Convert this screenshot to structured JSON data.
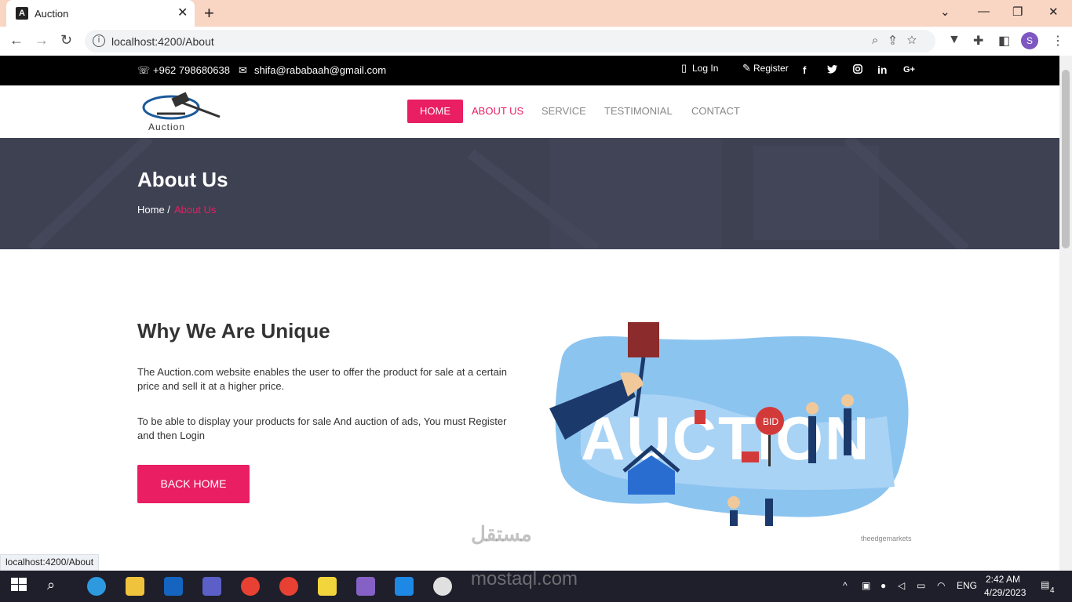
{
  "browser": {
    "tab_title": "Auction",
    "url": "localhost:4200/About",
    "status_url": "localhost:4200/About",
    "avatar_letter": "S"
  },
  "topbar": {
    "phone": "+962 798680638",
    "email": "shifa@rababaah@gmail.com",
    "login": "Log In",
    "register": "Register"
  },
  "logo_text": "Auction",
  "menu": [
    {
      "label": "HOME"
    },
    {
      "label": "ABOUT US"
    },
    {
      "label": "SERVICE"
    },
    {
      "label": "TESTIMONIAL"
    },
    {
      "label": "CONTACT"
    }
  ],
  "banner": {
    "title": "About Us",
    "breadcrumb_home": "Home /",
    "breadcrumb_current": "About Us"
  },
  "content": {
    "heading": "Why We Are Unique",
    "para1": "The Auction.com website enables the user to offer the product for sale at a certain price and sell it at a higher price.",
    "para2": "To be able to display your products for sale And auction of ads, You must Register and then Login",
    "button": "BACK HOME",
    "illustration_word": "AUCTION",
    "bid_sign": "BID",
    "image_credit": "theedgemarkets"
  },
  "watermark": {
    "arabic": "مستقل",
    "latin": "mostaql.com"
  },
  "taskbar": {
    "lang": "ENG",
    "time": "2:42 AM",
    "date": "4/29/2023",
    "notifications": "4"
  },
  "colors": {
    "accent": "#e91e63",
    "banner": "#3d4152",
    "topbar": "#000000",
    "tabbar": "#f9d5c3"
  }
}
